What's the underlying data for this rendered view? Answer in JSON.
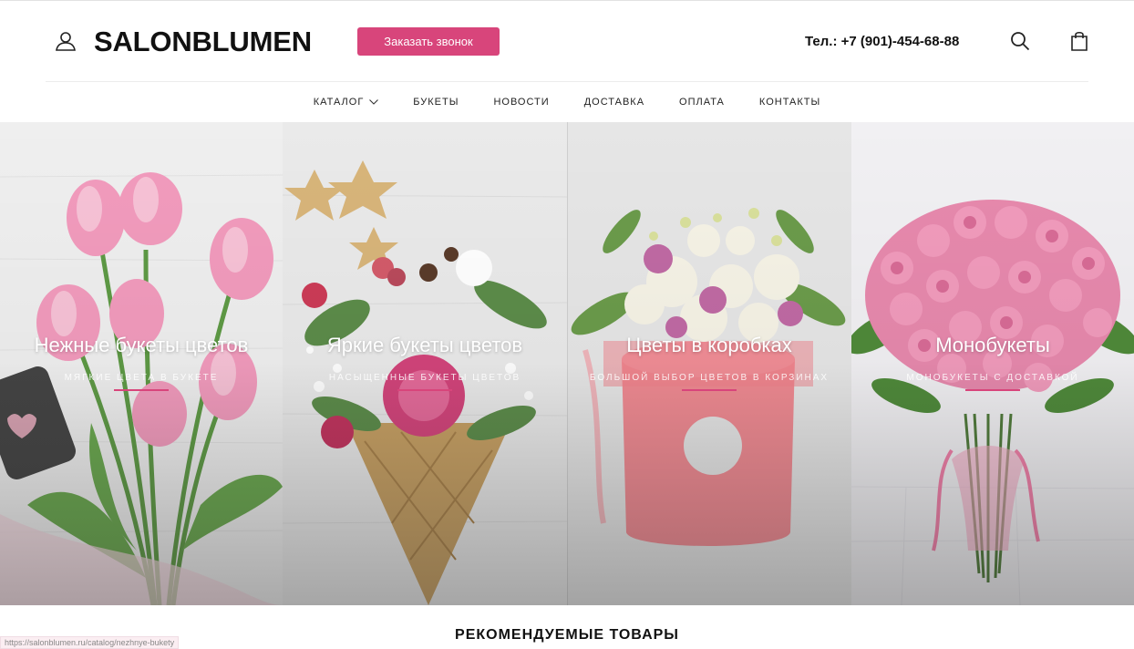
{
  "header": {
    "logo": "SALONBLUMEN",
    "callback_label": "Заказать звонок",
    "phone": "Тел.: +7 (901)-454-68-88"
  },
  "nav": {
    "items": [
      {
        "label": "КАТАЛОГ"
      },
      {
        "label": "БУКЕТЫ"
      },
      {
        "label": "НОВОСТИ"
      },
      {
        "label": "ДОСТАВКА"
      },
      {
        "label": "ОПЛАТА"
      },
      {
        "label": "КОНТАКТЫ"
      }
    ]
  },
  "banners": [
    {
      "title": "Нежные букеты цветов",
      "subtitle": "МЯГКИЕ ЦВЕТА В БУКЕТЕ"
    },
    {
      "title": "Яркие букеты цветов",
      "subtitle": "НАСЫЩЕННЫЕ БУКЕТЫ ЦВЕТОВ"
    },
    {
      "title": "Цветы в коробках",
      "subtitle": "БОЛЬШОЙ ВЫБОР ЦВЕТОВ В КОРЗИНАХ"
    },
    {
      "title": "Монобукеты",
      "subtitle": "МОНОБУКЕТЫ С ДОСТАВКОЙ"
    }
  ],
  "section_title": "РЕКОМЕНДУЕМЫЕ ТОВАРЫ",
  "status_url": "https://salonblumen.ru/catalog/nezhnye-bukety",
  "colors": {
    "accent": "#d8457b"
  },
  "icons": [
    "user-icon",
    "search-icon",
    "cart-icon",
    "chevron-down-icon"
  ]
}
